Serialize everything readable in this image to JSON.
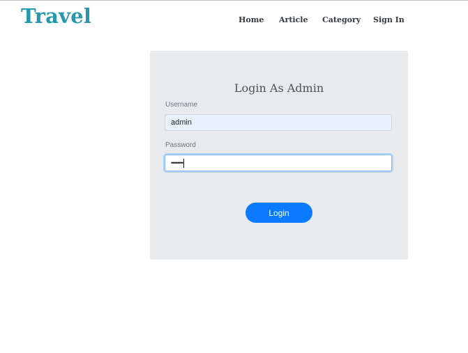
{
  "brand": {
    "name": "Travel",
    "color": "#2598ad"
  },
  "nav": {
    "items": [
      {
        "label": "Home"
      },
      {
        "label": "Article"
      },
      {
        "label": "Category"
      },
      {
        "label": "Sign In"
      }
    ]
  },
  "login_form": {
    "title": "Login As Admin",
    "username": {
      "label": "Username",
      "value": "admin"
    },
    "password": {
      "label": "Password",
      "value": "••••••••"
    },
    "submit_label": "Login",
    "button_color": "#0a7bff",
    "panel_color": "#e8ebee"
  }
}
